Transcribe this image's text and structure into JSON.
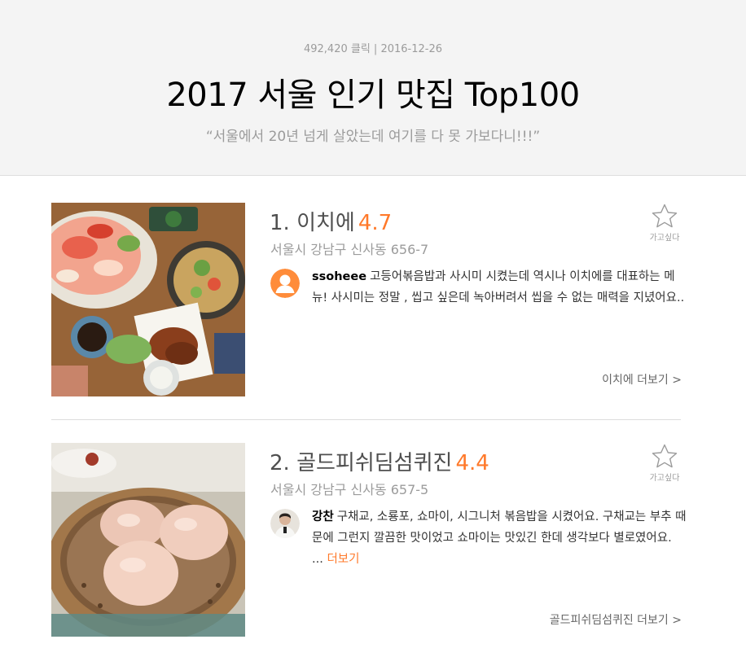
{
  "header": {
    "meta": "492,420 클릭 | 2016-12-26",
    "title": "2017 서울 인기 맛집 Top100",
    "subtitle": "“서울에서 20년 넘게 살았는데 여기를 다 못 가보다니!!!”"
  },
  "restaurants": [
    {
      "name": "1. 이치에",
      "rating": "4.7",
      "address": "서울시 강남구 신사동 656-7",
      "fav_label": "가고싶다",
      "review_user": "ssoheee",
      "review_text": "고등어볶음밥과 사시미 시켰는데 역시나 이치에를 대표하는 메뉴! 사시미는 정말 , 씹고 싶은데 녹아버려서 씹을 수 없는 매력을 지녔어요..",
      "review_more": "",
      "more_link": "이치에 더보기 >",
      "avatar_icon": "default-user-icon",
      "photo": "sashimi-platter-photo"
    },
    {
      "name": "2. 골드피쉬딤섬퀴진",
      "rating": "4.4",
      "address": "서울시 강남구 신사동 657-5",
      "fav_label": "가고싶다",
      "review_user": "강찬",
      "review_text": "구채교, 소룡포, 쇼마이, 시그니처 볶음밥을 시켰어요. 구채교는 부추 때문에 그런지 깔끔한 맛이었고 쇼마이는 맛있긴 한데 생각보다 별로였어요. ...",
      "review_more": "더보기",
      "more_link": "골드피쉬딤섬퀴진 더보기 >",
      "avatar_icon": "user-photo-avatar",
      "photo": "dim-sum-steamer-photo"
    }
  ],
  "colors": {
    "accent": "#ff792a",
    "header_bg": "#f4f4f4",
    "muted": "#9b9b9b"
  }
}
